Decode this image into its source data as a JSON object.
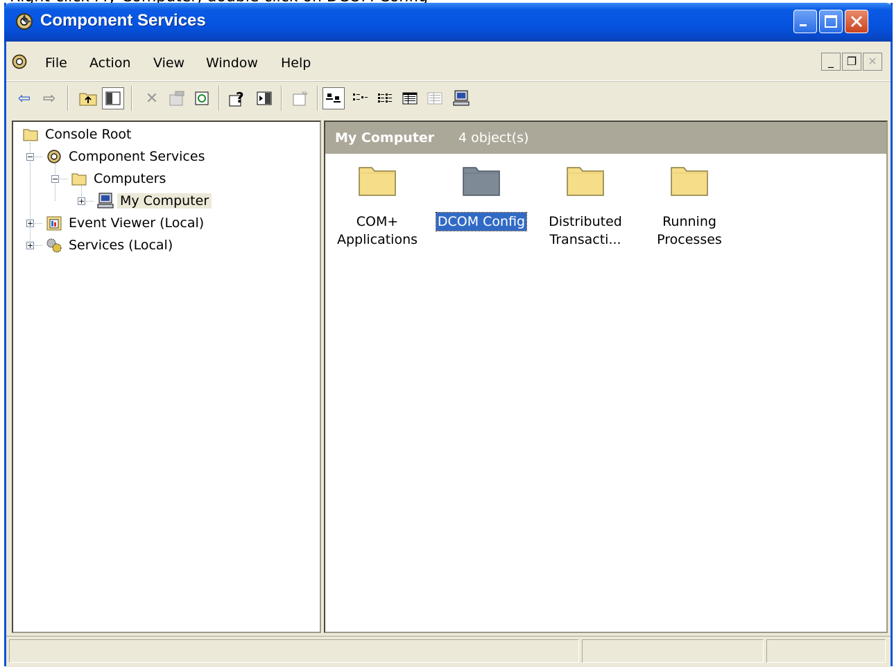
{
  "caption_text": "Right-click My Computer, double click on DCOM Config",
  "window": {
    "title": "Component Services"
  },
  "menu": {
    "items": [
      {
        "key": "file",
        "label": "File"
      },
      {
        "key": "action",
        "label": "Action"
      },
      {
        "key": "view",
        "label": "View"
      },
      {
        "key": "window",
        "label": "Window"
      },
      {
        "key": "help",
        "label": "Help"
      }
    ]
  },
  "toolbar": {
    "icons": [
      "back-arrow-icon",
      "forward-arrow-icon",
      "up-one-level-icon",
      "show-hide-tree-icon",
      "delete-icon",
      "properties-icon",
      "refresh-icon",
      "help-icon",
      "show-hide-action-pane-icon",
      "new-window-icon",
      "large-icons-view-icon",
      "small-icons-view-icon",
      "list-view-icon",
      "detail-view-icon",
      "configure-icon",
      "computer-icon"
    ]
  },
  "tree": {
    "items": [
      {
        "label": "Console Root",
        "icon": "folder-icon"
      },
      {
        "label": "Component Services",
        "icon": "component-services-icon"
      },
      {
        "label": "Computers",
        "icon": "folder-icon"
      },
      {
        "label": "My Computer",
        "icon": "computer-icon"
      },
      {
        "label": "Event Viewer (Local)",
        "icon": "event-viewer-icon"
      },
      {
        "label": "Services (Local)",
        "icon": "services-icon"
      }
    ]
  },
  "content": {
    "header_title": "My Computer",
    "header_count": "4 object(s)",
    "objects": [
      {
        "line1": "COM+",
        "line2": "Applications",
        "icon": "folder-icon"
      },
      {
        "line1": "DCOM Config",
        "line2": "",
        "icon": "folder-icon"
      },
      {
        "line1": "Distributed",
        "line2": "Transacti...",
        "icon": "folder-icon"
      },
      {
        "line1": "Running",
        "line2": "Processes",
        "icon": "folder-icon"
      }
    ]
  },
  "colors": {
    "titlebar": "#0553e0",
    "selection": "#316ac5",
    "header_band": "#aca899",
    "folder_yellow": "#f5dd8a",
    "folder_gray": "#7e8a96"
  }
}
